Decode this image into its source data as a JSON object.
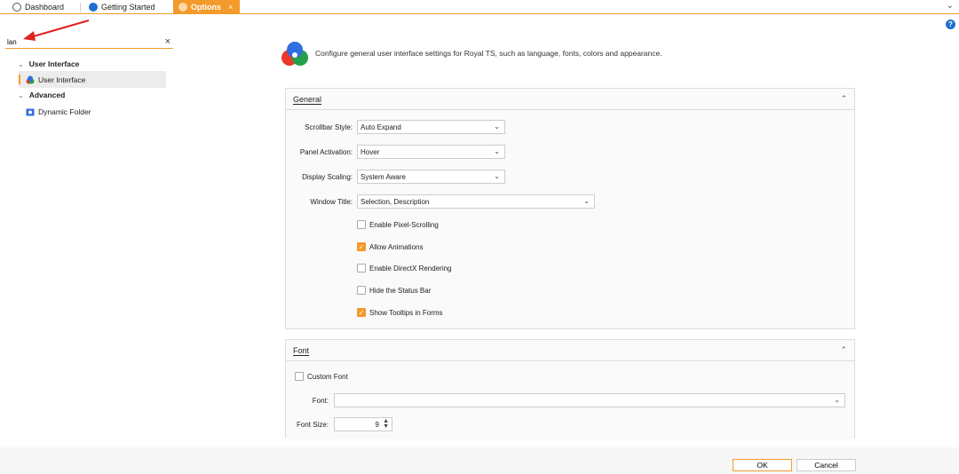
{
  "tabs": [
    {
      "label": "Dashboard",
      "icon": "dashboard-icon"
    },
    {
      "label": "Getting Started",
      "icon": "help-icon"
    },
    {
      "label": "Options",
      "icon": "gear-icon",
      "close": "×"
    }
  ],
  "search": {
    "value": "lan",
    "clear": "×"
  },
  "tree": {
    "group1": "User Interface",
    "item1": "User Interface",
    "group2": "Advanced",
    "item2": "Dynamic Folder"
  },
  "help": "?",
  "header": {
    "description": "Configure general user interface settings for Royal TS, such as language, fonts, colors and appearance."
  },
  "general": {
    "title": "General",
    "fields": [
      {
        "label": "Scrollbar Style:",
        "value": "Auto Expand"
      },
      {
        "label": "Panel Activation:",
        "value": "Hover"
      },
      {
        "label": "Display Scaling:",
        "value": "System Aware"
      },
      {
        "label": "Window Title:",
        "value": "Selection, Description"
      }
    ],
    "checkboxes": [
      {
        "label": "Enable Pixel-Scrolling",
        "checked": false
      },
      {
        "label": "Allow Animations",
        "checked": true
      },
      {
        "label": "Enable DirectX Rendering",
        "checked": false
      },
      {
        "label": "Hide the Status Bar",
        "checked": false
      },
      {
        "label": "Show Tooltips in Forms",
        "checked": true
      }
    ]
  },
  "font": {
    "title": "Font",
    "custom_font": "Custom Font",
    "font_label": "Font:",
    "font_value": "",
    "size_label": "Font Size:",
    "size_value": "9"
  },
  "buttons": {
    "ok": "OK",
    "cancel": "Cancel"
  },
  "colors": {
    "accent": "#f39a2b",
    "help": "#1e6fd0"
  }
}
